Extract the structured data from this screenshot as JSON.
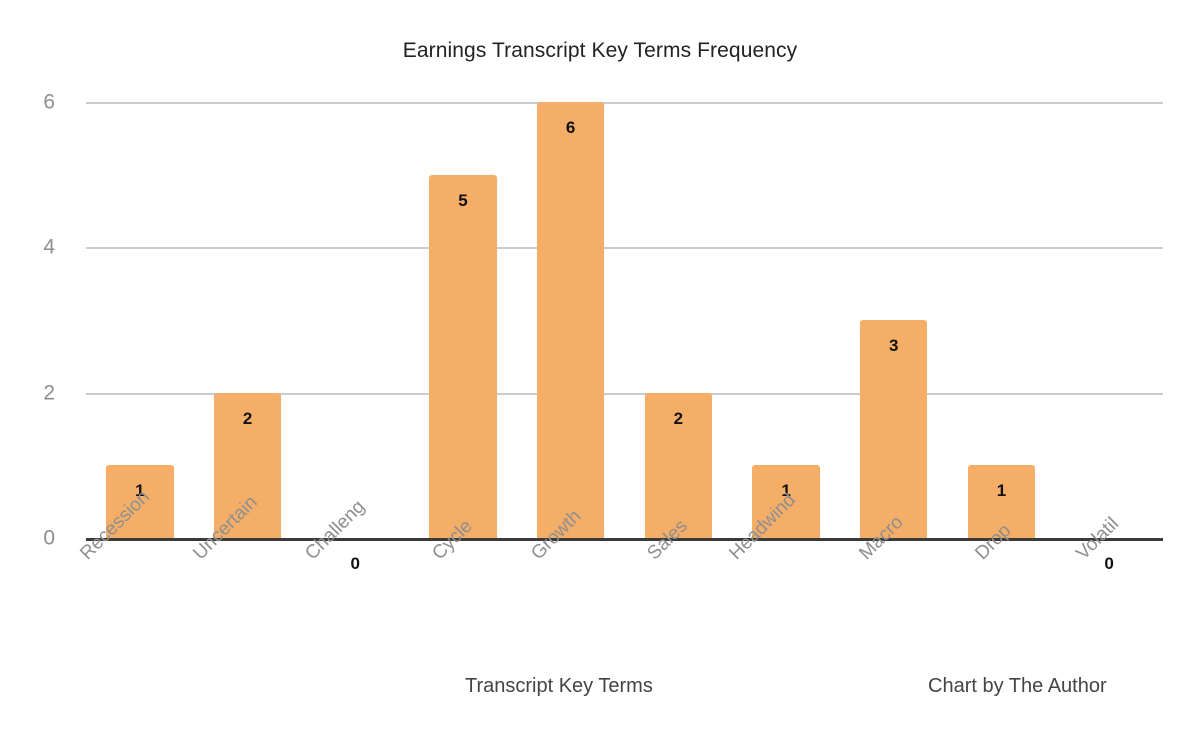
{
  "chart_data": {
    "type": "bar",
    "title": "Earnings Transcript Key Terms Frequency",
    "xlabel": "Transcript Key Terms",
    "ylabel": "",
    "categories": [
      "Recession",
      "Uncertain",
      "Challeng",
      "Cycle",
      "Growth",
      "Sales",
      "Headwind",
      "Macro",
      "Drop",
      "Volatil"
    ],
    "values": [
      1,
      2,
      0,
      5,
      6,
      2,
      1,
      3,
      1,
      0
    ],
    "data_labels": [
      "1",
      "2",
      "0",
      "5",
      "6",
      "2",
      "1",
      "3",
      "1",
      "0"
    ],
    "ylim": [
      0,
      6
    ],
    "yticks": [
      0,
      2,
      4,
      6
    ],
    "ytick_labels": [
      "0",
      "2",
      "4",
      "6"
    ],
    "grid": "horizontal",
    "legend": "none",
    "bar_color": "#f5ae67",
    "gridline_color": "#cccccc",
    "baseline_color": "#3a3a3a",
    "tick_label_color": "#8f8f8f",
    "title_color": "#222222",
    "annotation": "Chart by The Author"
  },
  "footer": {
    "axis_title": "Transcript Key Terms",
    "credit": "Chart by The Author"
  }
}
